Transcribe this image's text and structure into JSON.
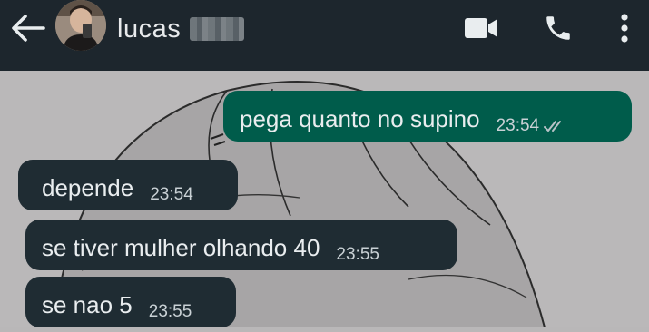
{
  "header": {
    "contact_name": "lucas",
    "icons": [
      "back-arrow-icon",
      "video-call-icon",
      "phone-icon",
      "more-vertical-icon"
    ]
  },
  "messages": [
    {
      "direction": "outgoing",
      "text": "pega quanto no supino",
      "time": "23:54",
      "status_icon": "double-check-icon"
    },
    {
      "direction": "incoming",
      "text": "depende",
      "time": "23:54"
    },
    {
      "direction": "incoming",
      "text": "se tiver mulher olhando 40",
      "time": "23:55"
    },
    {
      "direction": "incoming",
      "text": "se nao 5",
      "time": "23:55"
    }
  ],
  "colors": {
    "header_bg": "#1d262d",
    "incoming_bubble": "#1f2c33",
    "outgoing_bubble": "#005c4b",
    "wallpaper": "#b9b7b8"
  }
}
